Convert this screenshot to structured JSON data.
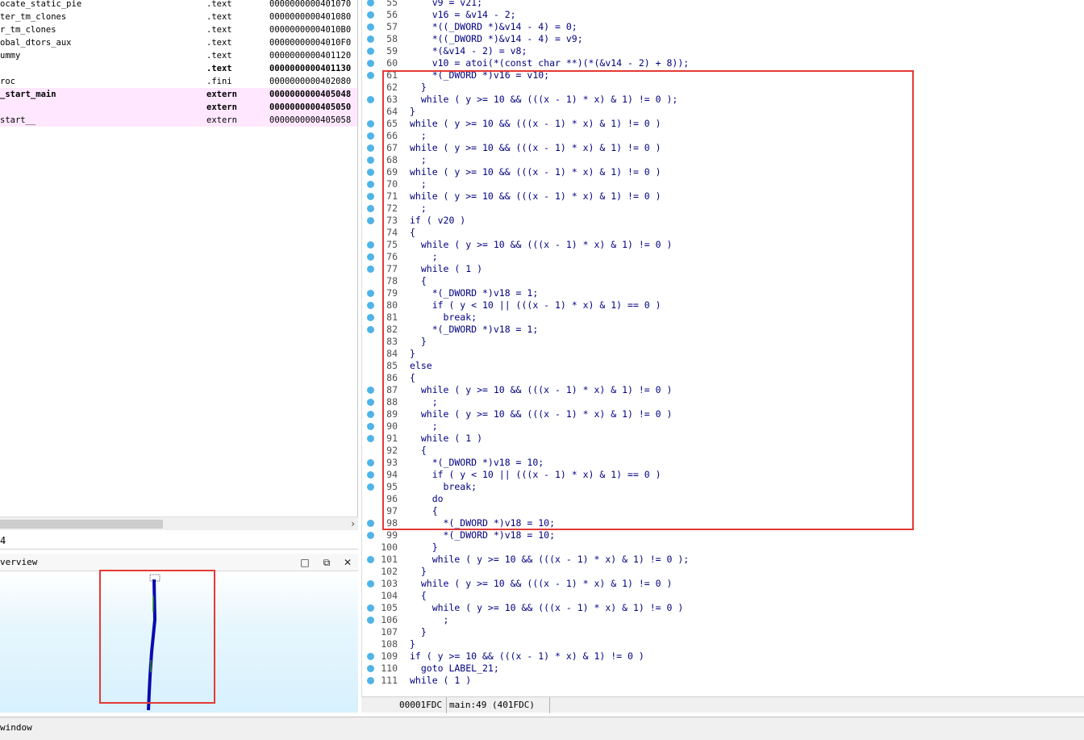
{
  "functions": {
    "rows": [
      {
        "name": "ocate_static_pie",
        "segment": ".text",
        "address": "0000000000401070",
        "bold": false,
        "pink": false
      },
      {
        "name": "ter_tm_clones",
        "segment": ".text",
        "address": "0000000000401080",
        "bold": false,
        "pink": false
      },
      {
        "name": "r_tm_clones",
        "segment": ".text",
        "address": "00000000004010B0",
        "bold": false,
        "pink": false
      },
      {
        "name": "obal_dtors_aux",
        "segment": ".text",
        "address": "00000000004010F0",
        "bold": false,
        "pink": false
      },
      {
        "name": "ummy",
        "segment": ".text",
        "address": "0000000000401120",
        "bold": false,
        "pink": false
      },
      {
        "name": "",
        "segment": ".text",
        "address": "0000000000401130",
        "bold": true,
        "pink": false
      },
      {
        "name": "roc",
        "segment": ".fini",
        "address": "0000000000402080",
        "bold": false,
        "pink": false
      },
      {
        "name": "_start_main",
        "segment": "extern",
        "address": "0000000000405048",
        "bold": true,
        "pink": true
      },
      {
        "name": "",
        "segment": "extern",
        "address": "0000000000405050",
        "bold": true,
        "pink": true
      },
      {
        "name": "start__",
        "segment": "extern",
        "address": "0000000000405058",
        "bold": false,
        "pink": true
      }
    ],
    "line_count": "4"
  },
  "overview": {
    "title": "verview",
    "buttons": {
      "maximize": "□",
      "restore": "⧉",
      "close": "✕"
    }
  },
  "code": {
    "lines": [
      {
        "n": "55",
        "dot": true,
        "t": "    v9 = v21;"
      },
      {
        "n": "56",
        "dot": true,
        "t": "    v16 = &v14 - 2;"
      },
      {
        "n": "57",
        "dot": true,
        "t": "    *((_DWORD *)&v14 - 4) = 0;"
      },
      {
        "n": "58",
        "dot": true,
        "t": "    *((_DWORD *)&v14 - 4) = v9;"
      },
      {
        "n": "59",
        "dot": true,
        "t": "    *(&v14 - 2) = v8;"
      },
      {
        "n": "60",
        "dot": true,
        "t": "    v10 = atoi(*(const char **)(*(&v14 - 2) + 8));"
      },
      {
        "n": "61",
        "dot": true,
        "t": "    *(_DWORD *)v16 = v10;"
      },
      {
        "n": "62",
        "dot": false,
        "t": "  }"
      },
      {
        "n": "63",
        "dot": true,
        "t": "  while ( y >= 10 && (((x - 1) * x) & 1) != 0 );"
      },
      {
        "n": "64",
        "dot": false,
        "t": "}"
      },
      {
        "n": "65",
        "dot": true,
        "t": "while ( y >= 10 && (((x - 1) * x) & 1) != 0 )"
      },
      {
        "n": "66",
        "dot": true,
        "t": "  ;"
      },
      {
        "n": "67",
        "dot": true,
        "t": "while ( y >= 10 && (((x - 1) * x) & 1) != 0 )"
      },
      {
        "n": "68",
        "dot": true,
        "t": "  ;"
      },
      {
        "n": "69",
        "dot": true,
        "t": "while ( y >= 10 && (((x - 1) * x) & 1) != 0 )"
      },
      {
        "n": "70",
        "dot": true,
        "t": "  ;"
      },
      {
        "n": "71",
        "dot": true,
        "t": "while ( y >= 10 && (((x - 1) * x) & 1) != 0 )"
      },
      {
        "n": "72",
        "dot": true,
        "t": "  ;"
      },
      {
        "n": "73",
        "dot": true,
        "t": "if ( v20 )"
      },
      {
        "n": "74",
        "dot": false,
        "t": "{"
      },
      {
        "n": "75",
        "dot": true,
        "t": "  while ( y >= 10 && (((x - 1) * x) & 1) != 0 )"
      },
      {
        "n": "76",
        "dot": true,
        "t": "    ;"
      },
      {
        "n": "77",
        "dot": true,
        "t": "  while ( 1 )"
      },
      {
        "n": "78",
        "dot": false,
        "t": "  {"
      },
      {
        "n": "79",
        "dot": true,
        "t": "    *(_DWORD *)v18 = 1;"
      },
      {
        "n": "80",
        "dot": true,
        "t": "    if ( y < 10 || (((x - 1) * x) & 1) == 0 )"
      },
      {
        "n": "81",
        "dot": true,
        "t": "      break;"
      },
      {
        "n": "82",
        "dot": true,
        "t": "    *(_DWORD *)v18 = 1;"
      },
      {
        "n": "83",
        "dot": false,
        "t": "  }"
      },
      {
        "n": "84",
        "dot": false,
        "t": "}"
      },
      {
        "n": "85",
        "dot": false,
        "t": "else"
      },
      {
        "n": "86",
        "dot": false,
        "t": "{"
      },
      {
        "n": "87",
        "dot": true,
        "t": "  while ( y >= 10 && (((x - 1) * x) & 1) != 0 )"
      },
      {
        "n": "88",
        "dot": true,
        "t": "    ;"
      },
      {
        "n": "89",
        "dot": true,
        "t": "  while ( y >= 10 && (((x - 1) * x) & 1) != 0 )"
      },
      {
        "n": "90",
        "dot": true,
        "t": "    ;"
      },
      {
        "n": "91",
        "dot": true,
        "t": "  while ( 1 )"
      },
      {
        "n": "92",
        "dot": false,
        "t": "  {"
      },
      {
        "n": "93",
        "dot": true,
        "t": "    *(_DWORD *)v18 = 10;"
      },
      {
        "n": "94",
        "dot": true,
        "t": "    if ( y < 10 || (((x - 1) * x) & 1) == 0 )"
      },
      {
        "n": "95",
        "dot": true,
        "t": "      break;"
      },
      {
        "n": "96",
        "dot": false,
        "t": "    do"
      },
      {
        "n": "97",
        "dot": false,
        "t": "    {"
      },
      {
        "n": "98",
        "dot": true,
        "t": "      *(_DWORD *)v18 = 10;"
      },
      {
        "n": "99",
        "dot": true,
        "t": "      *(_DWORD *)v18 = 10;"
      },
      {
        "n": "100",
        "dot": false,
        "t": "    }"
      },
      {
        "n": "101",
        "dot": true,
        "t": "    while ( y >= 10 && (((x - 1) * x) & 1) != 0 );"
      },
      {
        "n": "102",
        "dot": false,
        "t": "  }"
      },
      {
        "n": "103",
        "dot": true,
        "t": "  while ( y >= 10 && (((x - 1) * x) & 1) != 0 )"
      },
      {
        "n": "104",
        "dot": false,
        "t": "  {"
      },
      {
        "n": "105",
        "dot": true,
        "t": "    while ( y >= 10 && (((x - 1) * x) & 1) != 0 )"
      },
      {
        "n": "106",
        "dot": true,
        "t": "      ;"
      },
      {
        "n": "107",
        "dot": false,
        "t": "  }"
      },
      {
        "n": "108",
        "dot": false,
        "t": "}"
      },
      {
        "n": "109",
        "dot": true,
        "t": "if ( y >= 10 && (((x - 1) * x) & 1) != 0 )"
      },
      {
        "n": "110",
        "dot": true,
        "t": "  goto LABEL_21;"
      },
      {
        "n": "111",
        "dot": true,
        "t": "while ( 1 )"
      }
    ],
    "status": {
      "offset": "00001FDC",
      "location": "main:49 (401FDC)"
    }
  },
  "output": {
    "label": "window"
  },
  "colors": {
    "annotation": "#e53935",
    "code_text": "#000080",
    "breakpoint_dot": "#4fb4e8",
    "extern_highlight": "#ffe8ff"
  }
}
